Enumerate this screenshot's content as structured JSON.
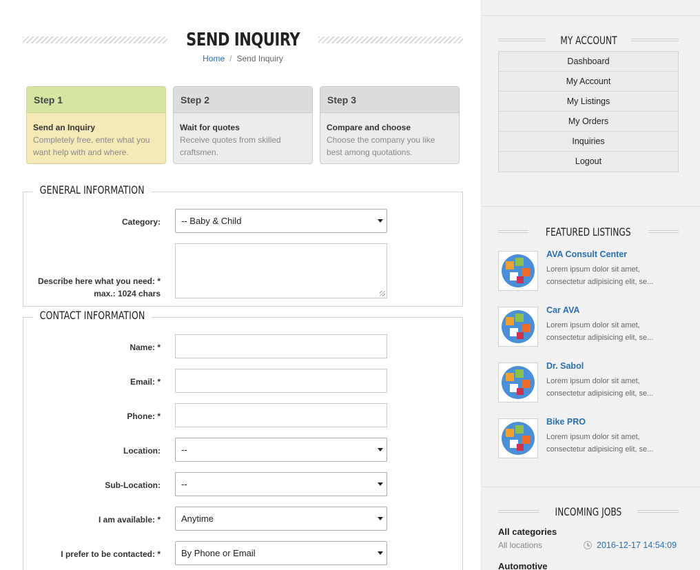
{
  "page": {
    "title": "SEND INQUIRY",
    "breadcrumb": {
      "home": "Home",
      "separator": "/",
      "current": "Send Inquiry"
    }
  },
  "steps": [
    {
      "label": "Step 1",
      "title": "Send an Inquiry",
      "desc": "Completely free, enter what you want help with and where.",
      "active": true
    },
    {
      "label": "Step 2",
      "title": "Wait for quotes",
      "desc": "Receive quotes from skilled craftsmen.",
      "active": false
    },
    {
      "label": "Step 3",
      "title": "Compare and choose",
      "desc": "Choose the company you like best among quotations.",
      "active": false
    }
  ],
  "general": {
    "legend": "GENERAL INFORMATION",
    "category_label": "Category:",
    "category_value": "-- Baby & Child",
    "describe_label": "Describe here what you need: *",
    "describe_hint": "max.: 1024 chars",
    "describe_value": ""
  },
  "contact": {
    "legend": "CONTACT INFORMATION",
    "name_label": "Name: *",
    "email_label": "Email: *",
    "phone_label": "Phone: *",
    "location_label": "Location:",
    "location_value": "--",
    "sublocation_label": "Sub-Location:",
    "sublocation_value": "--",
    "available_label": "I am available: *",
    "available_value": "Anytime",
    "contacted_label": "I prefer to be contacted: *",
    "contacted_value": "By Phone or Email"
  },
  "sidebar": {
    "account": {
      "title": "MY ACCOUNT",
      "items": [
        "Dashboard",
        "My Account",
        "My Listings",
        "My Orders",
        "Inquiries",
        "Logout"
      ]
    },
    "featured": {
      "title": "FEATURED LISTINGS",
      "items": [
        {
          "name": "AVA Consult Center",
          "desc": "Lorem ipsum dolor sit amet, consectetur adipisicing elit, se..."
        },
        {
          "name": "Car AVA",
          "desc": "Lorem ipsum dolor sit amet, consectetur adipisicing elit, se..."
        },
        {
          "name": "Dr. Sabol",
          "desc": "Lorem ipsum dolor sit amet, consectetur adipisicing elit, se..."
        },
        {
          "name": "Bike PRO",
          "desc": "Lorem ipsum dolor sit amet, consectetur adipisicing elit, se..."
        }
      ]
    },
    "jobs": {
      "title": "INCOMING JOBS",
      "category": "All categories",
      "location": "All locations",
      "time": "2016-12-17 14:54:09",
      "next_category": "Automotive"
    }
  },
  "colors": {
    "link": "#2a6fb0",
    "step_active_head": "#d5e6a3",
    "step_active_body": "#f6e9b8",
    "sidebar_bg": "#f1f1f1"
  }
}
